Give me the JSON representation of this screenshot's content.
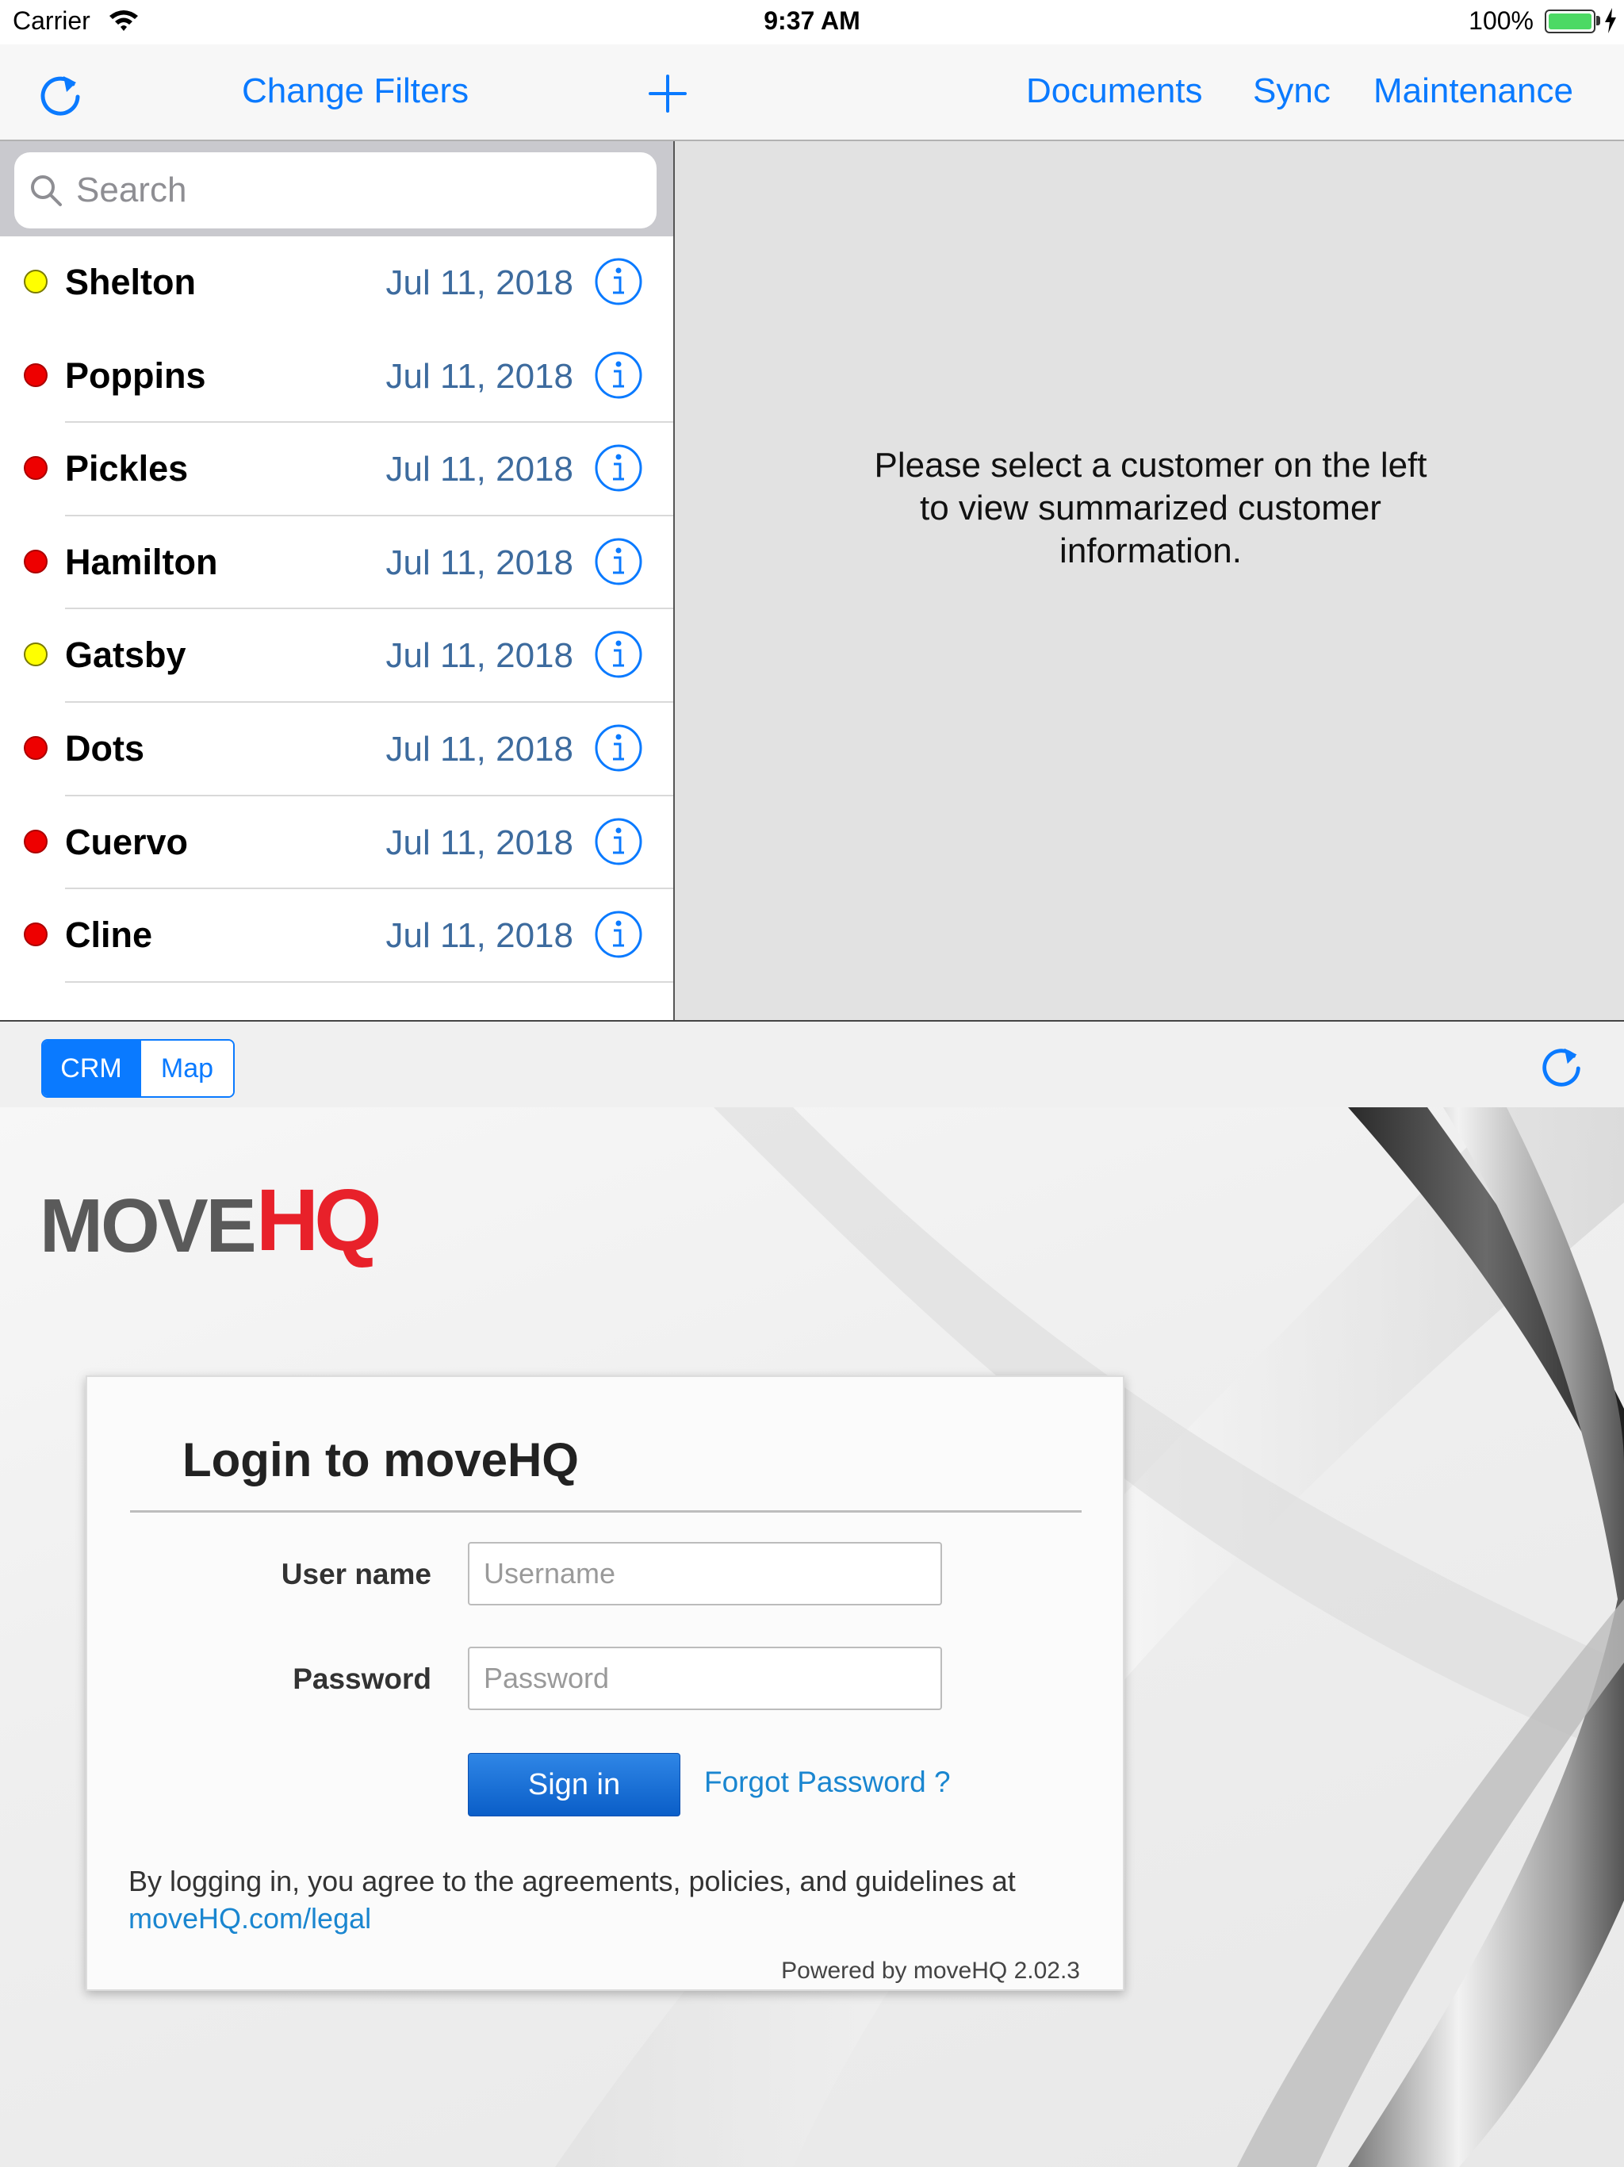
{
  "status_bar": {
    "carrier": "Carrier",
    "time": "9:37 AM",
    "battery": "100%"
  },
  "nav": {
    "change_filters": "Change Filters",
    "documents": "Documents",
    "sync": "Sync",
    "maintenance": "Maintenance",
    "icons": [
      "refresh-icon",
      "plus-icon"
    ]
  },
  "search": {
    "placeholder": "Search"
  },
  "customers": [
    {
      "name": "Shelton",
      "date": "Jul 11, 2018",
      "status": "yellow"
    },
    {
      "name": "Poppins",
      "date": "Jul 11, 2018",
      "status": "red"
    },
    {
      "name": "Pickles",
      "date": "Jul 11, 2018",
      "status": "red"
    },
    {
      "name": "Hamilton",
      "date": "Jul 11, 2018",
      "status": "red"
    },
    {
      "name": "Gatsby",
      "date": "Jul 11, 2018",
      "status": "yellow"
    },
    {
      "name": "Dots",
      "date": "Jul 11, 2018",
      "status": "red"
    },
    {
      "name": "Cuervo",
      "date": "Jul 11, 2018",
      "status": "red"
    },
    {
      "name": "Cline",
      "date": "Jul 11, 2018",
      "status": "red"
    }
  ],
  "detail": {
    "message": "Please select a customer on the left to view summarized customer information."
  },
  "segment": {
    "crm": "CRM",
    "map": "Map",
    "selected": "CRM"
  },
  "login": {
    "logo_move": "MOVE",
    "logo_hq": "HQ",
    "title": "Login to moveHQ",
    "username_label": "User name",
    "username_placeholder": "Username",
    "password_label": "Password",
    "password_placeholder": "Password",
    "sign_in": "Sign in",
    "forgot": "Forgot Password ?",
    "agreement": "By logging in, you agree to the agreements, policies, and guidelines at",
    "legal_link": "moveHQ.com/legal",
    "powered_by": "Powered by moveHQ 2.02.3"
  },
  "colors": {
    "tint": "#0a7aff",
    "status_yellow": "#ffff00",
    "status_red": "#ee0000",
    "logo_red": "#e8212a",
    "link": "#1a86d0"
  }
}
